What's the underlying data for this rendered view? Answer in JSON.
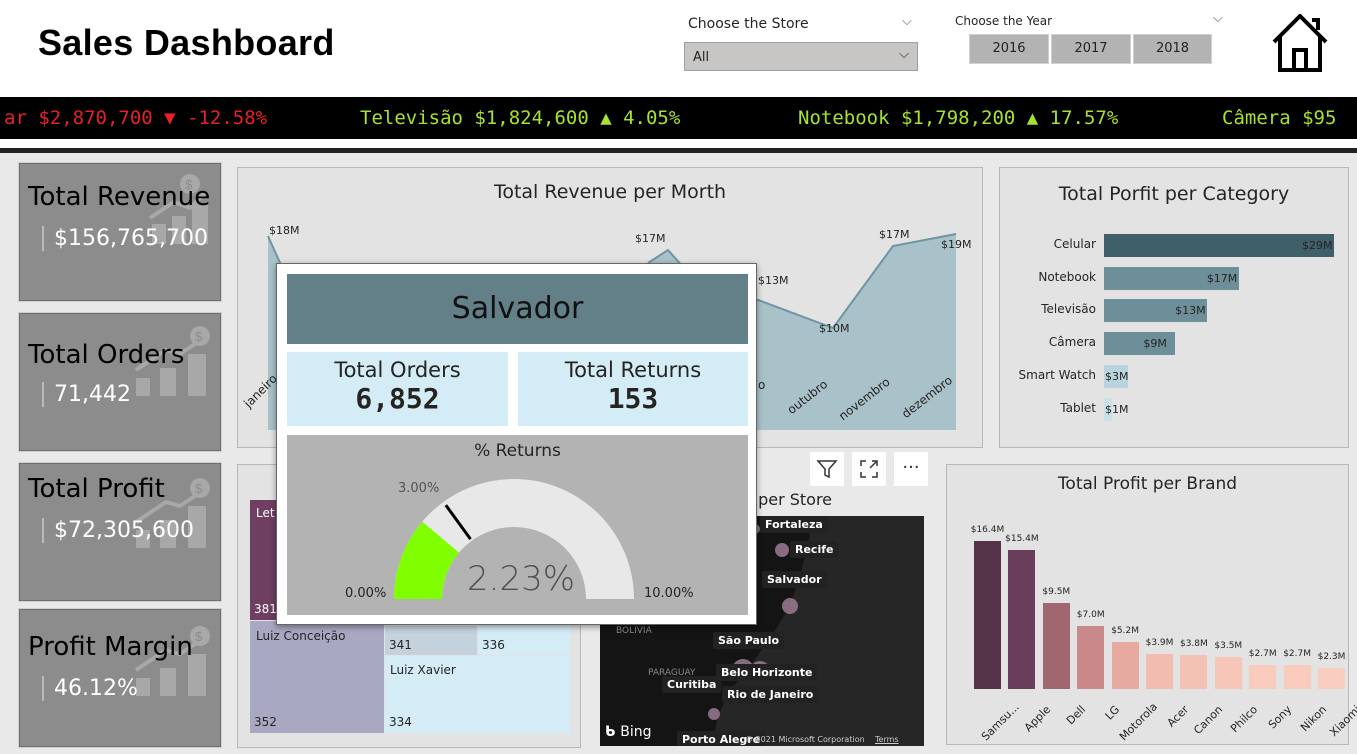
{
  "header": {
    "title": "Sales Dashboard",
    "store_slicer": {
      "label": "Choose the Store",
      "value": "All"
    },
    "year_slicer": {
      "label": "Choose the Year",
      "years": [
        "2016",
        "2017",
        "2018"
      ]
    },
    "home_icon": "home-icon"
  },
  "ticker": [
    {
      "text": "ar $2,870,700 ▼ -12.58%",
      "color": "#e8202a"
    },
    {
      "text": "Televisão $1,824,600 ▲ 4.05%",
      "color": "#a6e22e"
    },
    {
      "text": "Notebook $1,798,200 ▲ 17.57%",
      "color": "#a6e22e"
    },
    {
      "text": "Câmera $95",
      "color": "#a6e22e"
    }
  ],
  "kpis": [
    {
      "title": "Total Revenue",
      "value": "$156,765,700"
    },
    {
      "title": "Total Orders",
      "value": "71,442"
    },
    {
      "title": "Total Profit",
      "value": "$72,305,600"
    },
    {
      "title": "Profit Margin",
      "value": "46.12%"
    }
  ],
  "revenue_month": {
    "title": "Total Revenue per Morth",
    "visible_axis_labels": [
      "janeiro",
      "o",
      "outubro",
      "novembro",
      "dezembro"
    ],
    "point_labels": [
      {
        "label": "$18M",
        "value": 18
      },
      {
        "label": "$17M",
        "value": 17
      },
      {
        "label": "$13M",
        "value": 13
      },
      {
        "label": "$10M",
        "value": 10
      },
      {
        "label": "$17M",
        "value": 17
      },
      {
        "label": "$19M",
        "value": 19
      }
    ]
  },
  "profit_category": {
    "title": "Total Porfit per Category",
    "items": [
      {
        "name": "Celular",
        "value": 29,
        "label": "$29M",
        "color": "#3f5f69"
      },
      {
        "name": "Notebook",
        "value": 17,
        "label": "$17M",
        "color": "#6d8f99"
      },
      {
        "name": "Televisão",
        "value": 13,
        "label": "$13M",
        "color": "#6d8f99"
      },
      {
        "name": "Câmera",
        "value": 9,
        "label": "$9M",
        "color": "#6d8f99"
      },
      {
        "name": "Smart Watch",
        "value": 3,
        "label": "$3M",
        "color": "#b9d4dd"
      },
      {
        "name": "Tablet",
        "value": 1,
        "label": "$1M",
        "color": "#c9e2ea"
      }
    ]
  },
  "profit_brand": {
    "title": "Total Profit per Brand",
    "items": [
      {
        "name": "Samsu...",
        "value": 16.4,
        "label": "$16.4M",
        "color": "#55344a"
      },
      {
        "name": "Apple",
        "value": 15.4,
        "label": "$15.4M",
        "color": "#6a3e5a"
      },
      {
        "name": "Dell",
        "value": 9.5,
        "label": "$9.5M",
        "color": "#a06670"
      },
      {
        "name": "LG",
        "value": 7.0,
        "label": "$7.0M",
        "color": "#c9898a"
      },
      {
        "name": "Motorola",
        "value": 5.2,
        "label": "$5.2M",
        "color": "#e6aaa1"
      },
      {
        "name": "Acer",
        "value": 3.9,
        "label": "$3.9M",
        "color": "#f2bdb0"
      },
      {
        "name": "Canon",
        "value": 3.8,
        "label": "$3.8M",
        "color": "#f4c2b4"
      },
      {
        "name": "Philco",
        "value": 3.5,
        "label": "$3.5M",
        "color": "#f6c6b8"
      },
      {
        "name": "Sony",
        "value": 2.7,
        "label": "$2.7M",
        "color": "#f8cbbd"
      },
      {
        "name": "Nikon",
        "value": 2.7,
        "label": "$2.7M",
        "color": "#f8cbbd"
      },
      {
        "name": "Xiaomi",
        "value": 2.3,
        "label": "$2.3M",
        "color": "#f9cec0"
      }
    ]
  },
  "treemap": {
    "cells": [
      {
        "name": "Let",
        "value": "381"
      },
      {
        "name": "Luiz Conceição",
        "value": "352"
      },
      {
        "name": "",
        "value": "341"
      },
      {
        "name": "",
        "value": "336"
      },
      {
        "name": "Luiz Xavier",
        "value": "334"
      }
    ]
  },
  "map": {
    "title_fragment": "ue per Store",
    "cities": [
      "Fortaleza",
      "Recife",
      "Salvador",
      "São Paulo",
      "Belo Horizonte",
      "Curitiba",
      "Rio de Janeiro",
      "Porto Alegre"
    ],
    "regions": [
      "BOLIVIA",
      "PARAGUAY"
    ],
    "bing": "Bing",
    "copyright": "© 2021 Microsoft Corporation",
    "terms": "Terms"
  },
  "tooltip": {
    "store": "Salvador",
    "orders_label": "Total Orders",
    "orders_value": "6,852",
    "returns_label": "Total Returns",
    "returns_value": "153",
    "gauge_title": "% Returns",
    "gauge_value_text": "2.23%",
    "gauge_value": 2.23,
    "gauge_target_text": "3.00%",
    "gauge_target": 3.0,
    "gauge_min_text": "0.00%",
    "gauge_max_text": "10.00%",
    "gauge_max": 10
  },
  "colors": {
    "header_tile": "#637f87",
    "light_tile": "#d3ecf5",
    "gauge_fill": "#80ff00"
  }
}
